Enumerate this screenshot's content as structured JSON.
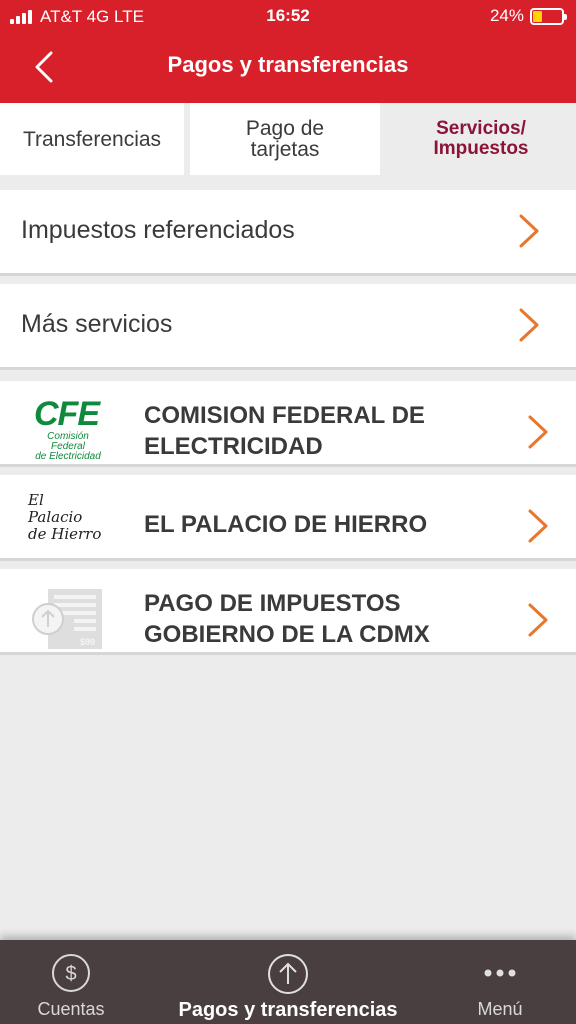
{
  "status_bar": {
    "carrier": "AT&T 4G  LTE",
    "time": "16:52",
    "battery": "24%",
    "battery_level": 0.24
  },
  "header": {
    "title": "Pagos y transferencias",
    "back_icon": "chevron-left-icon"
  },
  "tabs": [
    {
      "label": "Transferencias",
      "active": false
    },
    {
      "label": "Pago de\ntarjetas",
      "active": false
    },
    {
      "label": "Servicios/\nImpuestos",
      "active": true
    }
  ],
  "menu": {
    "impuestos_referenciados": "Impuestos referenciados",
    "mas_servicios": "Más servicios"
  },
  "merchants": [
    {
      "name": "COMISION FEDERAL DE\nELECTRICIDAD",
      "logo": "cfe-logo",
      "logo_text": {
        "brand": "CFE",
        "sub": "Comisión\nFederal\nde Electricidad"
      }
    },
    {
      "name": "EL PALACIO DE HIERRO",
      "logo": "palacio-de-hierro-logo",
      "logo_text": {
        "brand": "El\nPalacio\nde Hierro"
      }
    },
    {
      "name": "PAGO DE IMPUESTOS\nGOBIERNO DE LA CDMX",
      "logo": "tax-receipt-icon",
      "logo_text": {
        "amount": "$99"
      }
    }
  ],
  "tabbar": {
    "items": [
      {
        "label": "Cuentas",
        "icon": "dollar-circle-icon",
        "active": false
      },
      {
        "label": "Pagos y transferencias",
        "icon": "upload-circle-icon",
        "active": true
      },
      {
        "label": "Menú",
        "icon": "more-dots-icon",
        "active": false
      }
    ]
  },
  "colors": {
    "brand_red": "#d8202b",
    "accent_orange": "#e8762d",
    "active_tab_text": "#8a1538",
    "tabbar_bg": "#4a3f40",
    "cfe_green": "#0f8a3c"
  }
}
